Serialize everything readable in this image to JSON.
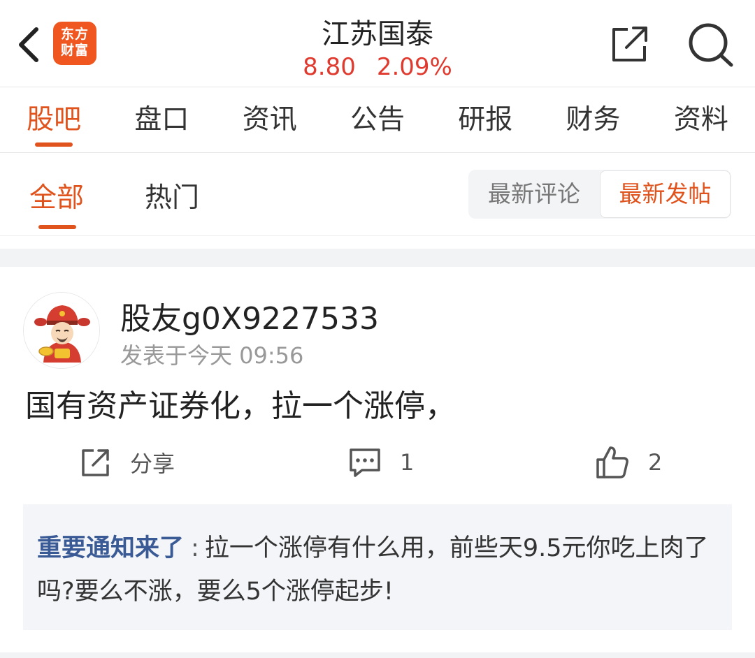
{
  "header": {
    "title": "江苏国泰",
    "price": "8.80",
    "change_percent": "2.09%",
    "logo_line1": "东方",
    "logo_line2": "财富",
    "accent_color": "#e0531d",
    "up_color": "#e0392e"
  },
  "main_tabs": [
    {
      "label": "股吧",
      "active": true
    },
    {
      "label": "盘口"
    },
    {
      "label": "资讯"
    },
    {
      "label": "公告"
    },
    {
      "label": "研报"
    },
    {
      "label": "财务"
    },
    {
      "label": "资料"
    }
  ],
  "sub_tabs": {
    "all": "全部",
    "hot": "热门",
    "sort_latest_comment": "最新评论",
    "sort_latest_post": "最新发帖"
  },
  "post": {
    "username": "股友g0X9227533",
    "time": "发表于今天 09:56",
    "content": "国有资产证券化，拉一个涨停，",
    "share_label": "分享",
    "comment_count": "1",
    "like_count": "2",
    "reply": {
      "author": "重要通知来了",
      "separator": ":",
      "text": "拉一个涨停有什么用，前些天9.5元你吃上肉了吗?要么不涨，要么5个涨停起步!"
    }
  },
  "icons": [
    "back-icon",
    "app-logo",
    "share-icon",
    "search-icon",
    "avatar-caishen",
    "comment-icon",
    "like-icon"
  ]
}
